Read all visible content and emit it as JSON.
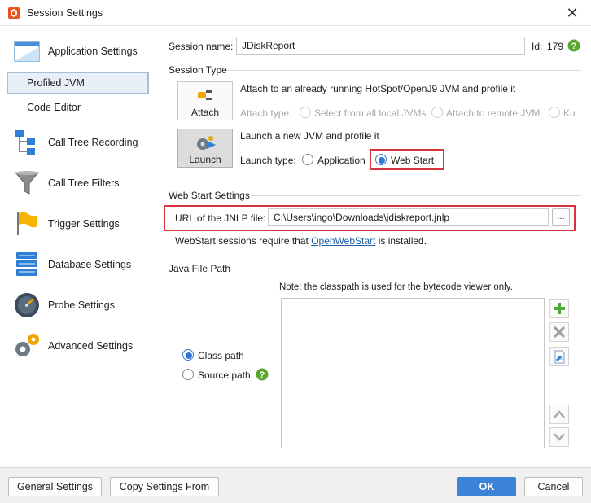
{
  "window": {
    "title": "Session Settings",
    "close_glyph": "✕"
  },
  "sidebar": {
    "items": [
      {
        "label": "Application Settings",
        "icon": "application-window-icon"
      },
      {
        "label": "Profiled JVM",
        "selected": true
      },
      {
        "label": "Code Editor"
      },
      {
        "label": "Call Tree Recording",
        "icon": "call-tree-icon"
      },
      {
        "label": "Call Tree Filters",
        "icon": "funnel-icon"
      },
      {
        "label": "Trigger Settings",
        "icon": "flag-icon"
      },
      {
        "label": "Database Settings",
        "icon": "database-icon"
      },
      {
        "label": "Probe Settings",
        "icon": "gauge-icon"
      },
      {
        "label": "Advanced Settings",
        "icon": "gears-icon"
      }
    ]
  },
  "main": {
    "session_name_label": "Session name:",
    "session_name_value": "JDiskReport",
    "id_label": "Id:",
    "id_value": "179",
    "session_type_title": "Session Type",
    "attach": {
      "button_label": "Attach",
      "description": "Attach to an already running HotSpot/OpenJ9 JVM and profile it",
      "type_label": "Attach type:",
      "options": [
        "Select from all local JVMs",
        "Attach to remote JVM",
        "Ku"
      ]
    },
    "launch": {
      "button_label": "Launch",
      "description": "Launch a new JVM and profile it",
      "type_label": "Launch type:",
      "options": [
        "Application",
        "Web Start"
      ],
      "selected": "Web Start"
    },
    "webstart_title": "Web Start Settings",
    "jnlp_label": "URL of the JNLP file:",
    "jnlp_value": "C:\\Users\\ingo\\Downloads\\jdiskreport.jnlp",
    "browse_label": "...",
    "webstart_note_prefix": "WebStart sessions require that",
    "webstart_note_link": "OpenWebStart",
    "webstart_note_suffix": "is installed.",
    "java_path_title": "Java File Path",
    "classpath_note": "Note: the classpath is used for the bytecode viewer only.",
    "path_options": [
      "Class path",
      "Source path"
    ],
    "path_selected": "Class path"
  },
  "footer": {
    "general_settings": "General Settings",
    "copy_settings": "Copy Settings From",
    "ok": "OK",
    "cancel": "Cancel"
  },
  "colors": {
    "accent": "#3a83d6",
    "highlight_red": "#d6353d",
    "help_green": "#5aa632",
    "add_green": "#4ea83a"
  }
}
